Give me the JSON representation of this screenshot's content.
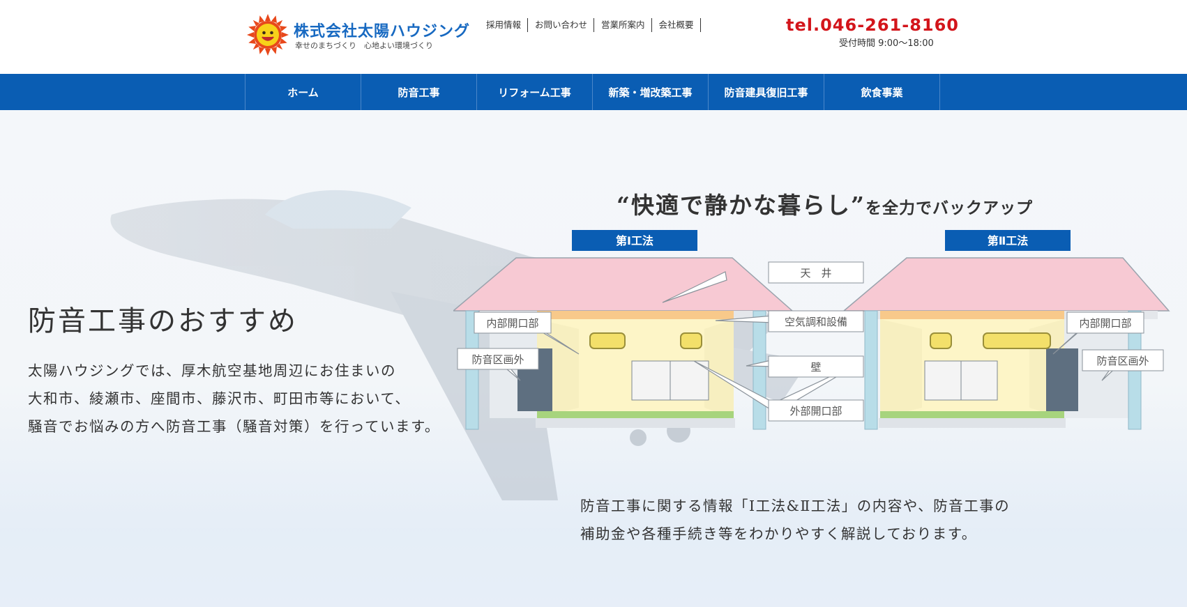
{
  "header": {
    "company_name": "株式会社太陽ハウジング",
    "tagline": "幸せのまちづくり　心地よい環境づくり",
    "util_links": [
      "採用情報",
      "お問い合わせ",
      "営業所案内",
      "会社概要"
    ],
    "tel": "tel.046-261-8160",
    "hours": "受付時間 9:00〜18:00",
    "brand_color": "#1769c1",
    "tel_color": "#d3151b"
  },
  "nav": {
    "items": [
      "ホーム",
      "防音工事",
      "リフォーム工事",
      "新築・増改築工事",
      "防音建具復旧工事",
      "飲食事業"
    ],
    "bg_color": "#0a5db3"
  },
  "hero": {
    "title": "防音工事のおすすめ",
    "desc_lines": [
      "太陽ハウジングでは、厚木航空基地周辺にお住まいの",
      "大和市、綾瀬市、座間市、藤沢市、町田市等において、",
      "騒音でお悩みの方へ防音工事（騒音対策）を行っています。"
    ],
    "catch_main": "“快適で静かな暮らし”",
    "catch_sub": "を全力でバックアップ",
    "bottom_lines": [
      "防音工事に関する情報「Ⅰ工法&Ⅱ工法」の内容や、防音工事の",
      "補助金や各種手続き等をわかりやすく解説しております。"
    ]
  },
  "diagram": {
    "method1": "第Ⅰ工法",
    "method2": "第Ⅱ工法",
    "labels": {
      "ceiling": "天　井",
      "aircon": "空気調和設備",
      "wall": "壁",
      "exterior_opening": "外部開口部",
      "inner_opening_left": "内部開口部",
      "outside_left": "防音区画外",
      "inner_opening_right": "内部開口部",
      "outside_right": "防音区画外"
    }
  }
}
